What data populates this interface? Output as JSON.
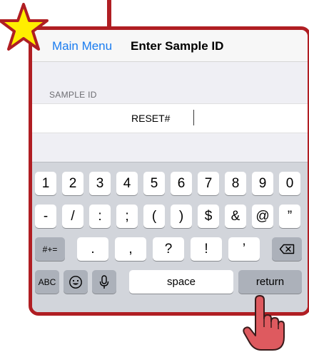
{
  "navbar": {
    "back_label": "Main Menu",
    "title": "Enter Sample ID"
  },
  "form": {
    "section_label": "SAMPLE ID",
    "value": "RESET#"
  },
  "keyboard": {
    "row1": [
      "1",
      "2",
      "3",
      "4",
      "5",
      "6",
      "7",
      "8",
      "9",
      "0"
    ],
    "row2": [
      "-",
      "/",
      ":",
      ";",
      "(",
      ")",
      "$",
      "&",
      "@",
      "”"
    ],
    "row3": {
      "symbols_toggle": "#+=",
      "keys": [
        ".",
        ",",
        "?",
        "!",
        "’"
      ],
      "delete_icon": "backspace-icon"
    },
    "row4": {
      "abc_toggle": "ABC",
      "emoji_icon": "emoji-icon",
      "mic_icon": "microphone-icon",
      "space_label": "space",
      "return_label": "return"
    }
  },
  "annotations": {
    "star_icon": "star-badge-icon",
    "pointer_icon": "pointing-hand-icon",
    "highlight_color": "#b01e23"
  }
}
